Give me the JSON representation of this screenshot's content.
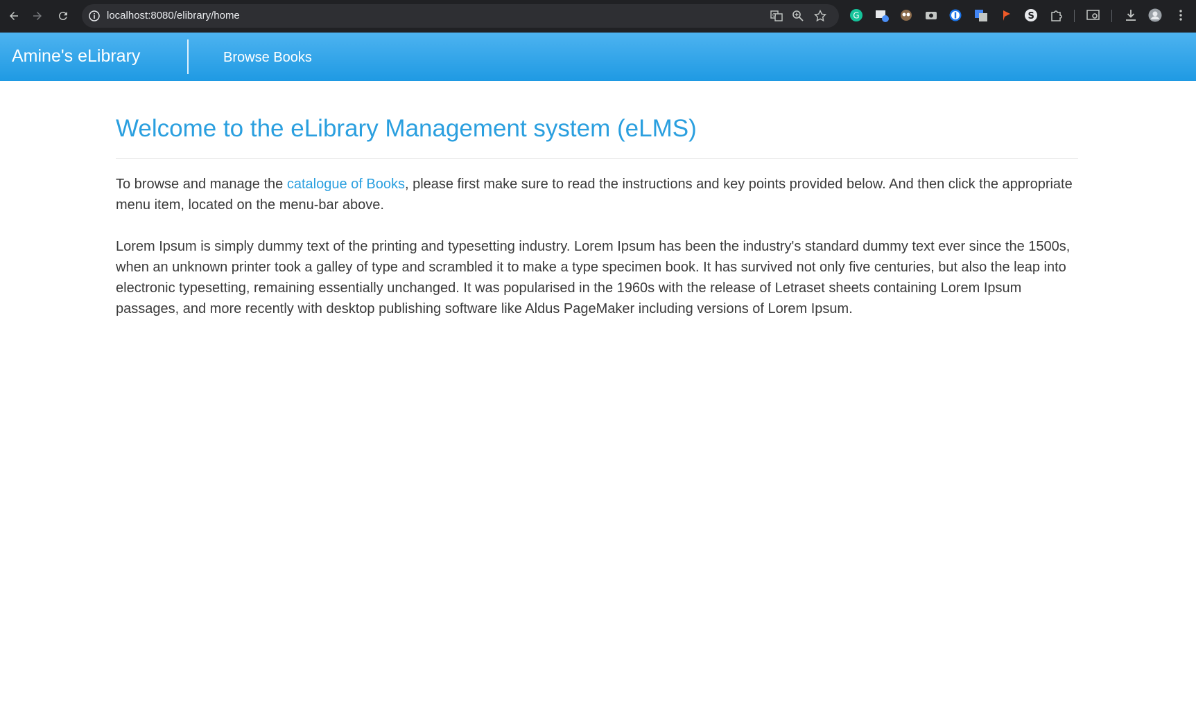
{
  "browser": {
    "url": "localhost:8080/elibrary/home",
    "icons": [
      "back-arrow-icon",
      "forward-arrow-icon",
      "reload-icon",
      "site-info-icon",
      "translate-icon",
      "zoom-icon",
      "bookmark-star-icon",
      "grammarly-extension-icon",
      "screen-extension-icon",
      "owl-extension-icon",
      "camera-extension-icon",
      "password-extension-icon",
      "google-translate-extension-icon",
      "flag-extension-icon",
      "s-extension-icon",
      "extensions-puzzle-icon",
      "search-tab-icon",
      "download-icon",
      "profile-avatar-icon",
      "more-menu-icon"
    ]
  },
  "navbar": {
    "brand": "Amine's eLibrary",
    "links": [
      {
        "label": "Browse Books"
      }
    ],
    "colors": {
      "top": "#4db3f0",
      "bottom": "#1f9ae3"
    }
  },
  "main": {
    "title": "Welcome to the eLibrary Management system (eLMS)",
    "intro": {
      "before_link": "To browse and manage the ",
      "link_text": "catalogue of Books",
      "after_link": ", please first make sure to read the instructions and key points provided below. And then click the appropriate menu item, located on the menu-bar above."
    },
    "body": "Lorem Ipsum is simply dummy text of the printing and typesetting industry. Lorem Ipsum has been the industry's standard dummy text ever since the 1500s, when an unknown printer took a galley of type and scrambled it to make a type specimen book. It has survived not only five centuries, but also the leap into electronic typesetting, remaining essentially unchanged. It was popularised in the 1960s with the release of Letraset sheets containing Lorem Ipsum passages, and more recently with desktop publishing software like Aldus PageMaker including versions of Lorem Ipsum."
  },
  "colors": {
    "accent": "#2a9fdf",
    "text": "#3a3a3a",
    "chrome": "#202124"
  }
}
